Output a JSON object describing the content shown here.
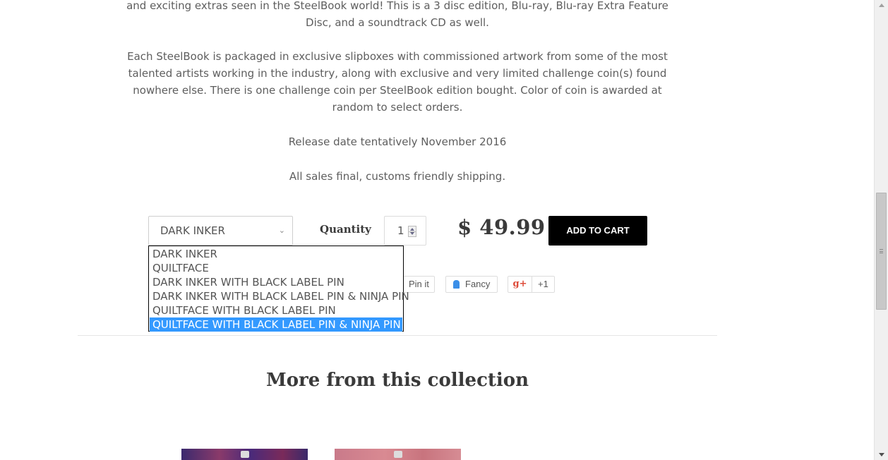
{
  "description": {
    "p1": "and exciting extras seen in the SteelBook world!  This is a 3 disc edition,  Blu-ray, Blu-ray Extra Feature Disc, and a soundtrack CD as well.",
    "p2": "Each SteelBook is packaged in exclusive slipboxes with commissioned artwork from some of the most talented artists working in the industry, along with exclusive and very limited challenge coin(s) found nowhere else.  There is one challenge coin per SteelBook edition bought.  Color of coin is awarded at random to select orders.",
    "p3": "Release date tentatively November 2016",
    "p4": "All sales final, customs friendly shipping."
  },
  "product": {
    "variant_selected": "DARK INKER",
    "variant_options": [
      "DARK INKER",
      "QUILTFACE",
      "DARK INKER WITH BLACK LABEL PIN",
      "DARK INKER WITH BLACK LABEL PIN & NINJA PIN",
      "QUILTFACE WITH BLACK LABEL PIN",
      "QUILTFACE WITH BLACK LABEL PIN & NINJA PIN"
    ],
    "highlighted_option": "QUILTFACE WITH BLACK LABEL PIN & NINJA PIN",
    "quantity_label": "Quantity",
    "quantity_value": "1",
    "price": "$ 49.99",
    "add_to_cart_label": "ADD TO CART"
  },
  "social": {
    "pin_label": "Pin it",
    "fancy_label": "Fancy",
    "gplus_label": "g+",
    "gplus_count": "+1"
  },
  "collection": {
    "title": "More from this collection"
  },
  "colors": {
    "add_to_cart_bg": "#000000",
    "dropdown_highlight": "#3399ff",
    "fancy_icon": "#3b8fe8",
    "gplus_icon": "#dd4b39"
  }
}
